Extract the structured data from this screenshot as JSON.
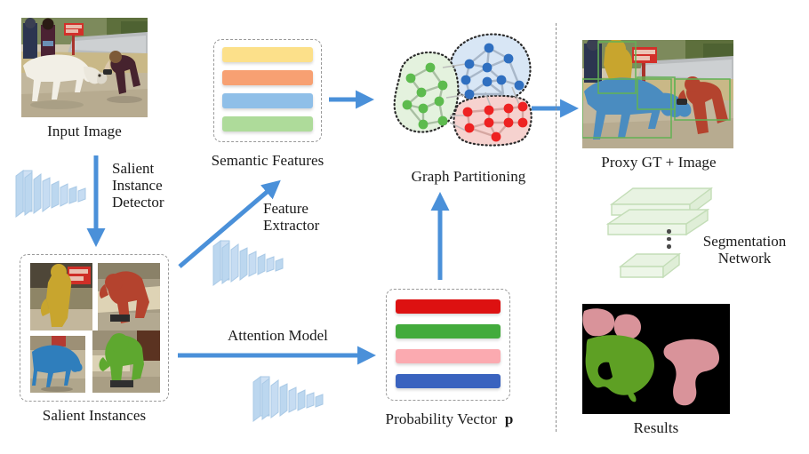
{
  "figure": {
    "type": "pipeline-diagram",
    "background": "#ffffff",
    "divider": "vertical-dashed-separator"
  },
  "colors": {
    "arrow_blue": "#4a90d9",
    "cnn_blue": "#bcd7ef",
    "dash_gray": "#9a9a9a",
    "semantic_yellow": "#fce08a",
    "semantic_orange": "#f7a072",
    "semantic_blue": "#8fbfe8",
    "semantic_green": "#aedb9a",
    "prob_red": "#dd1111",
    "prob_green": "#43ab3c",
    "prob_pink": "#fbaab0",
    "prob_blue": "#3a63bf",
    "graph_green": "#5dbb4e",
    "graph_blue": "#2f6fc0",
    "graph_red": "#ee2222",
    "cluster_green_fill": "#e4f2de",
    "cluster_blue_fill": "#d8e6f5",
    "cluster_red_fill": "#f6d2cf",
    "slab_green": "#e8f3e2",
    "slab_edge": "#c3ddb7",
    "result_pink": "#d9939a",
    "result_green": "#5ea024",
    "result_bg": "#000000"
  },
  "nodes": {
    "input_image": {
      "caption": "Input Image",
      "kind": "photo",
      "description": "cow and people on roadside"
    },
    "salient_instances": {
      "caption": "Salient Instances",
      "kind": "photo-grid",
      "tiles": [
        {
          "name": "instance-yellow",
          "color": "#c8a52e"
        },
        {
          "name": "instance-red",
          "color": "#b4432e"
        },
        {
          "name": "instance-blue",
          "color": "#2f7ebc"
        },
        {
          "name": "instance-green",
          "color": "#5ea82f"
        }
      ]
    },
    "semantic_features": {
      "caption": "Semantic Features",
      "kind": "bar-stack",
      "bars": [
        {
          "name": "feature-bar-yellow",
          "color": "#fce08a"
        },
        {
          "name": "feature-bar-orange",
          "color": "#f7a072"
        },
        {
          "name": "feature-bar-blue",
          "color": "#8fbfe8"
        },
        {
          "name": "feature-bar-green",
          "color": "#aedb9a"
        }
      ]
    },
    "probability_vector": {
      "caption": "Probability Vector",
      "caption_symbol": "p",
      "kind": "bar-stack",
      "bars": [
        {
          "name": "prob-bar-red",
          "color": "#dd1111"
        },
        {
          "name": "prob-bar-green",
          "color": "#43ab3c"
        },
        {
          "name": "prob-bar-pink",
          "color": "#fbaab0"
        },
        {
          "name": "prob-bar-blue",
          "color": "#3a63bf"
        }
      ]
    },
    "graph_partitioning": {
      "caption": "Graph Partitioning",
      "kind": "graph-clusters",
      "clusters": [
        {
          "name": "cluster-green",
          "node_color": "#5dbb4e",
          "fill": "#e4f2de",
          "node_count": 9
        },
        {
          "name": "cluster-blue",
          "node_color": "#2f6fc0",
          "fill": "#d8e6f5",
          "node_count": 9
        },
        {
          "name": "cluster-red",
          "node_color": "#ee2222",
          "fill": "#f6d2cf",
          "node_count": 9
        }
      ]
    },
    "proxy_gt": {
      "caption": "Proxy GT + Image",
      "kind": "photo",
      "description": "cow and people with colored instance masks and green boxes"
    },
    "segmentation_network": {
      "caption": "Segmentation Network",
      "caption_line1": "Segmentation",
      "caption_line2": "Network",
      "kind": "slab-stack",
      "slab_count": 3
    },
    "results": {
      "caption": "Results",
      "kind": "photo",
      "description": "segmentation mask on black background"
    }
  },
  "edges": [
    {
      "name": "edge-salient-instance-detector",
      "label_lines": [
        "Salient",
        "Instance",
        "Detector"
      ],
      "direction": "down"
    },
    {
      "name": "edge-feature-extractor",
      "label_lines": [
        "Feature",
        "Extractor"
      ],
      "direction": "up-right"
    },
    {
      "name": "edge-attention-model",
      "label_lines": [
        "Attention Model"
      ],
      "direction": "right"
    },
    {
      "name": "edge-semantic-to-graph",
      "label_lines": [],
      "direction": "right"
    },
    {
      "name": "edge-prob-to-graph",
      "label_lines": [],
      "direction": "up"
    },
    {
      "name": "edge-graph-to-proxy",
      "label_lines": [],
      "direction": "right"
    }
  ]
}
